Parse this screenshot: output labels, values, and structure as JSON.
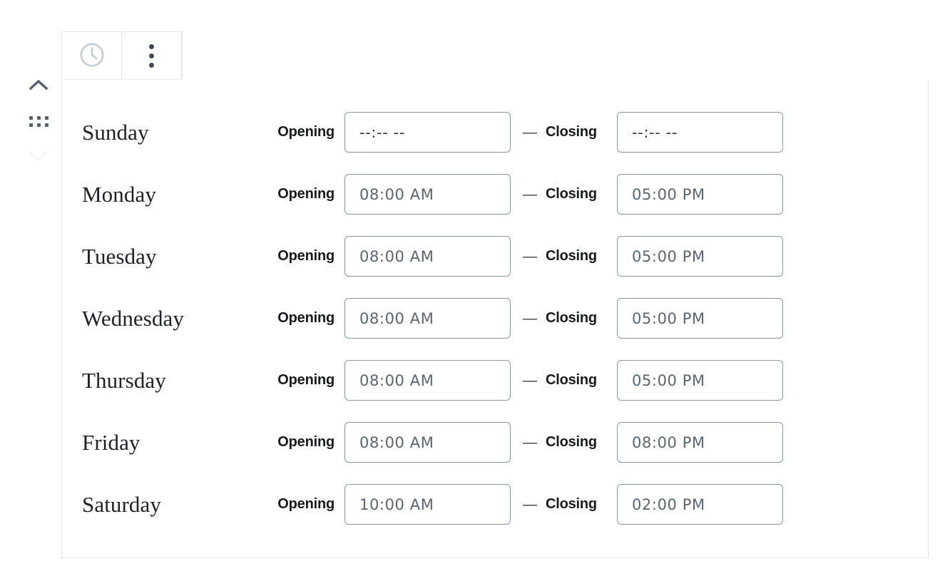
{
  "left_rail": {
    "move_up_label": "chevron-up",
    "drag_handle_label": "drag-handle",
    "move_down_label": "chevron-down"
  },
  "block_toolbar": {
    "clock_button_label": "clock-icon",
    "options_button_label": "more-options"
  },
  "panel": {
    "separator": "—",
    "opening_label": "Opening",
    "closing_label": "Closing",
    "time_placeholder": "--:-- --",
    "rows": [
      {
        "day": "Sunday",
        "opening": "",
        "closing": ""
      },
      {
        "day": "Monday",
        "opening": "08:00 AM",
        "closing": "05:00 PM"
      },
      {
        "day": "Tuesday",
        "opening": "08:00 AM",
        "closing": "05:00 PM"
      },
      {
        "day": "Wednesday",
        "opening": "08:00 AM",
        "closing": "05:00 PM"
      },
      {
        "day": "Thursday",
        "opening": "08:00 AM",
        "closing": "05:00 PM"
      },
      {
        "day": "Friday",
        "opening": "08:00 AM",
        "closing": "08:00 PM"
      },
      {
        "day": "Saturday",
        "opening": "10:00 AM",
        "closing": "02:00 PM"
      }
    ]
  },
  "colors": {
    "panel_border": "#e3e5e7",
    "input_border": "#8b95a1",
    "icon_active": "#3f4a5a",
    "icon_muted": "#c5cbd1",
    "icon_disabled": "#f4f7f7",
    "text_primary": "#1f2125"
  }
}
